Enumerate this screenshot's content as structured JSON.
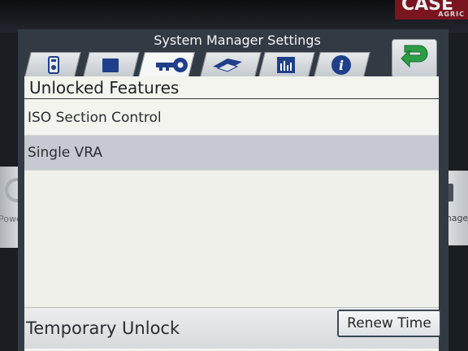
{
  "brand": {
    "name": "CASE",
    "sub": "AGRIC"
  },
  "window": {
    "title": "System Manager Settings"
  },
  "tabs": [
    {
      "icon": "device-icon"
    },
    {
      "icon": "folder-icon"
    },
    {
      "icon": "key-icon",
      "active": true
    },
    {
      "icon": "implement-icon"
    },
    {
      "icon": "bar-chart-icon"
    },
    {
      "icon": "info-icon",
      "glyph": "i"
    }
  ],
  "back_button": {
    "icon": "back-arrow-icon"
  },
  "section": {
    "title": "Unlocked Features"
  },
  "features": [
    {
      "label": "ISO Section Control",
      "selected": false
    },
    {
      "label": "Single VRA",
      "selected": true
    }
  ],
  "temporary_unlock": {
    "label": "Temporary Unlock",
    "button": "Renew Time"
  },
  "side": {
    "left_label": "Powe",
    "right_label": "anager"
  },
  "colors": {
    "accent_green": "#2a9d45",
    "header_bg": "#323a44",
    "selected_row": "#c6cad0"
  }
}
